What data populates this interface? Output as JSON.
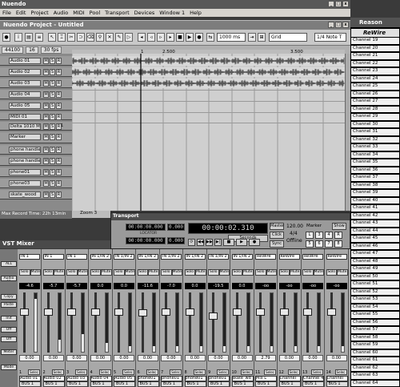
{
  "app": {
    "title": "Nuendo",
    "menu": [
      "File",
      "Edit",
      "Project",
      "Audio",
      "MIDI",
      "Pool",
      "Transport",
      "Devices",
      "Window 1",
      "Help"
    ]
  },
  "project": {
    "title": "Nuendo Project - Untitled",
    "toolbar": {
      "zoom_value": "1000 ms",
      "grid_label": "Grid",
      "quantize_label": "1/4 Note T"
    },
    "infoline": [
      "44100",
      "16",
      "30 fps"
    ],
    "ruler_marks": [
      "1",
      "2.500",
      "3.500"
    ],
    "tracks": [
      {
        "name": "Audio 01"
      },
      {
        "name": "Audio 02"
      },
      {
        "name": "Audio 03"
      },
      {
        "name": "Audio 04"
      },
      {
        "name": "Audio 05"
      },
      {
        "name": "MIDI 01"
      },
      {
        "name": "Delta 1010 MIDI",
        "extra": "1"
      },
      {
        "name": "Marker"
      },
      {
        "name": "phone handle 0"
      },
      {
        "name": "phone handle 0"
      },
      {
        "name": "phone01"
      },
      {
        "name": "phone03"
      },
      {
        "name": "skate_wood"
      }
    ],
    "status": "Max Record Time: 22h 13min",
    "zoom": "Zoom 3"
  },
  "transport": {
    "title": "Transport",
    "left_locator": "00:00:00.000",
    "left_value": "0.000",
    "right_locator": "00:00:00.000",
    "right_value": "0.000",
    "locator_label": "LOCATOR",
    "position": "00:00:02.310",
    "seconds_label": "Seconds",
    "tempo": "120.00",
    "signature": "4/4",
    "offline": "Offline",
    "master_label": "Master",
    "click_label": "Click",
    "sync_label": "Sync",
    "marker_label": "Marker",
    "show_label": "Show",
    "marker_keys": [
      "L",
      "3",
      "4",
      "R",
      "5",
      "6",
      "7",
      "8"
    ]
  },
  "reason": {
    "title": "Reason",
    "header": "ReWire",
    "channels": [
      "Channel 19",
      "Channel 20",
      "Channel 21",
      "Channel 22",
      "Channel 23",
      "Channel 24",
      "Channel 25",
      "Channel 26",
      "Channel 27",
      "Channel 28",
      "Channel 29",
      "Channel 30",
      "Channel 31",
      "Channel 32",
      "Channel 33",
      "Channel 34",
      "Channel 35",
      "Channel 36",
      "Channel 37",
      "Channel 38",
      "Channel 39",
      "Channel 40",
      "Channel 41",
      "Channel 42",
      "Channel 43",
      "Channel 44",
      "Channel 45",
      "Channel 46",
      "Channel 47",
      "Channel 48",
      "Channel 49",
      "Channel 50",
      "Channel 51",
      "Channel 52",
      "Channel 53",
      "Channel 54",
      "Channel 55",
      "Channel 56",
      "Channel 57",
      "Channel 58",
      "Channel 59",
      "Channel 60",
      "Channel 61",
      "Channel 62",
      "Channel 63",
      "Channel 64"
    ]
  },
  "mixer": {
    "title": "VST Mixer",
    "side_labels": [
      "ALL",
      "Audio 01",
      "Copy",
      "Paste",
      "Init",
      "Off",
      "Off",
      "Meter",
      "Mode"
    ],
    "strips": [
      {
        "input": "IN 1",
        "vol": "-4.6",
        "level": "0.00",
        "num": "1",
        "name": "Audio 01",
        "bus": "BUS 1",
        "fader": 0.7,
        "meter": 0.9
      },
      {
        "input": "IN 1",
        "vol": "-5.7",
        "level": "0.00",
        "num": "2",
        "name": "Audio 02",
        "bus": "BUS 1",
        "fader": 0.7,
        "meter": 0.2
      },
      {
        "input": "IN 1",
        "vol": "-5.7",
        "level": "0.00",
        "num": "3",
        "name": "Audio 03",
        "bus": "BUS 1",
        "fader": 0.7,
        "meter": 0.3
      },
      {
        "input": "IN 1/IN 2",
        "vol": "0.0",
        "level": "0.00",
        "num": "4",
        "name": "Audio 04",
        "bus": "BUS 1",
        "fader": 0.7,
        "meter": 0.15
      },
      {
        "input": "IN 1/IN 2",
        "vol": "0.0",
        "level": "0.00",
        "num": "5",
        "name": "Audio 05",
        "bus": "BUS 1",
        "fader": 0.7,
        "meter": 0.1
      },
      {
        "input": "IN 1/IN 2",
        "vol": "-11.6",
        "level": "0.00",
        "num": "6",
        "name": "phone01",
        "bus": "BUS 1",
        "fader": 0.68,
        "meter": 0.1
      },
      {
        "input": "IN 1/IN 2",
        "vol": "-7.0",
        "level": "0.00",
        "num": "7",
        "name": "phone01",
        "bus": "BUS 1",
        "fader": 0.7,
        "meter": 0.1
      },
      {
        "input": "IN 1/IN 2",
        "vol": "0.0",
        "level": "0.00",
        "num": "8",
        "name": "phone01",
        "bus": "BUS 1",
        "fader": 0.7,
        "meter": 0.1
      },
      {
        "input": "IN 1/IN 2",
        "vol": "-19.5",
        "level": "0.00",
        "num": "9",
        "name": "phone01",
        "bus": "BUS 1",
        "fader": 0.62,
        "meter": 0.1
      },
      {
        "input": "IN 1/IN 2",
        "vol": "0.0",
        "level": "0.00",
        "num": "10",
        "name": "skate_wd",
        "bus": "BUS 1",
        "fader": 0.7,
        "meter": 0.1
      },
      {
        "input": "ReWire",
        "vol": "-oo",
        "level": "2.79",
        "num": "11",
        "name": "Mix L",
        "bus": "BUS 1",
        "fader": 0.7,
        "meter": 0.1
      },
      {
        "input": "ReWire",
        "vol": "-oo",
        "level": "0.00",
        "num": "12",
        "name": "Channel",
        "bus": "BUS 1",
        "fader": 0.7,
        "meter": 0.1
      },
      {
        "input": "ReWire",
        "vol": "-oo",
        "level": "0.00",
        "num": "13",
        "name": "Channel 4",
        "bus": "BUS 1",
        "fader": 0.7,
        "meter": 0.1
      },
      {
        "input": "ReWire",
        "vol": "-oo",
        "level": "0.00",
        "num": "14",
        "name": "Channel",
        "bus": "BUS 1",
        "fader": 0.7,
        "meter": 0.1
      }
    ]
  }
}
